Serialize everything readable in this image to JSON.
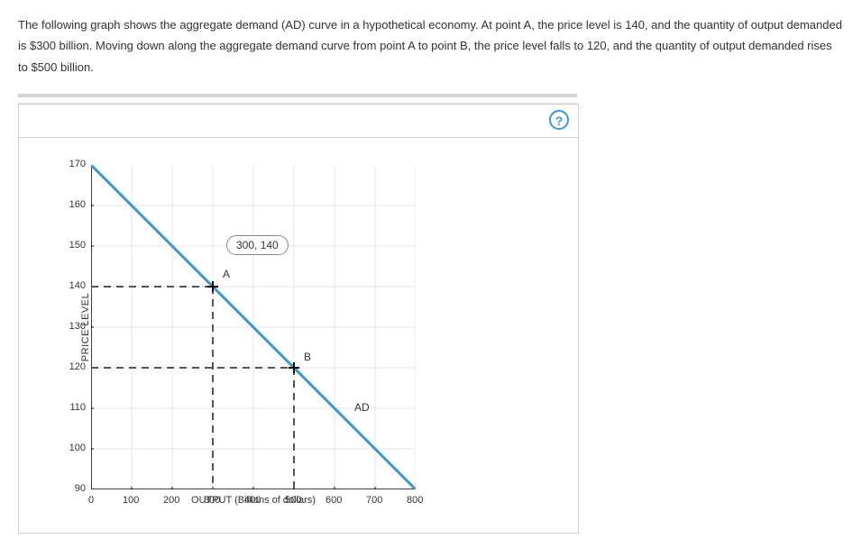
{
  "question": {
    "text": "The following graph shows the aggregate demand (AD) curve in a hypothetical economy. At point A, the price level is 140, and the quantity of output demanded is $300 billion. Moving down along the aggregate demand curve from point A to point B, the price level falls to 120, and the quantity of output demanded rises to $500 billion."
  },
  "toolbar": {
    "help": "?"
  },
  "chart_data": {
    "type": "line",
    "title": "",
    "xlabel": "OUTPUT (Billions of dollars)",
    "ylabel": "PRICE LEVEL",
    "xlim": [
      0,
      800
    ],
    "ylim": [
      90,
      170
    ],
    "x_ticks": [
      0,
      100,
      200,
      300,
      400,
      500,
      600,
      700,
      800
    ],
    "y_ticks": [
      90,
      100,
      110,
      120,
      130,
      140,
      150,
      160,
      170
    ],
    "series": [
      {
        "name": "AD",
        "x": [
          0,
          800
        ],
        "y": [
          170,
          90
        ],
        "color": "#3b97d3"
      }
    ],
    "points": [
      {
        "name": "A",
        "x": 300,
        "y": 140
      },
      {
        "name": "B",
        "x": 500,
        "y": 120
      }
    ],
    "tooltip": {
      "for": "A",
      "text": "300, 140"
    }
  }
}
